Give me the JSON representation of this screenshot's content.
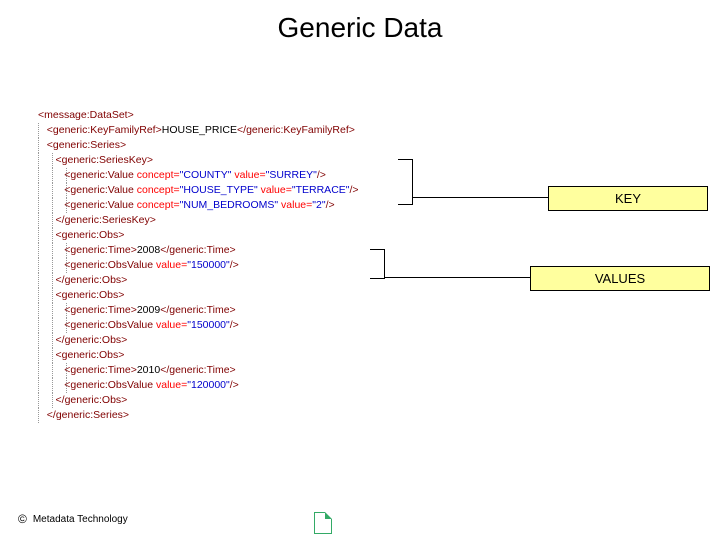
{
  "title": "Generic Data",
  "callouts": {
    "key": "KEY",
    "values": "VALUES"
  },
  "footer": {
    "copyright": "©",
    "text": "Metadata Technology"
  },
  "xml": {
    "dataset_open": "<message:DataSet>",
    "kfref_open": "<generic:KeyFamilyRef>",
    "kfref_text": "HOUSE_PRICE",
    "kfref_close": "</generic:KeyFamilyRef>",
    "series_open": "<generic:Series>",
    "serieskey_open": "<generic:SeriesKey>",
    "value_tag": "<generic:Value",
    "concept_attr": " concept=",
    "value_attr": " value=",
    "selfclose": "/>",
    "concepts": [
      "\"COUNTY\"",
      "\"HOUSE_TYPE\"",
      "\"NUM_BEDROOMS\""
    ],
    "concept_vals": [
      "\"SURREY\"",
      "\"TERRACE\"",
      "\"2\""
    ],
    "serieskey_close": "</generic:SeriesKey>",
    "obs_open": "<generic:Obs>",
    "time_open": "<generic:Time>",
    "time_close": "</generic:Time>",
    "times": [
      "2008",
      "2009",
      "2010"
    ],
    "obsvalue_tag": "<generic:ObsValue",
    "obs_values": [
      "\"150000\"",
      "\"150000\"",
      "\"120000\""
    ],
    "obs_close": "</generic:Obs>",
    "series_close": "</generic:Series>"
  }
}
